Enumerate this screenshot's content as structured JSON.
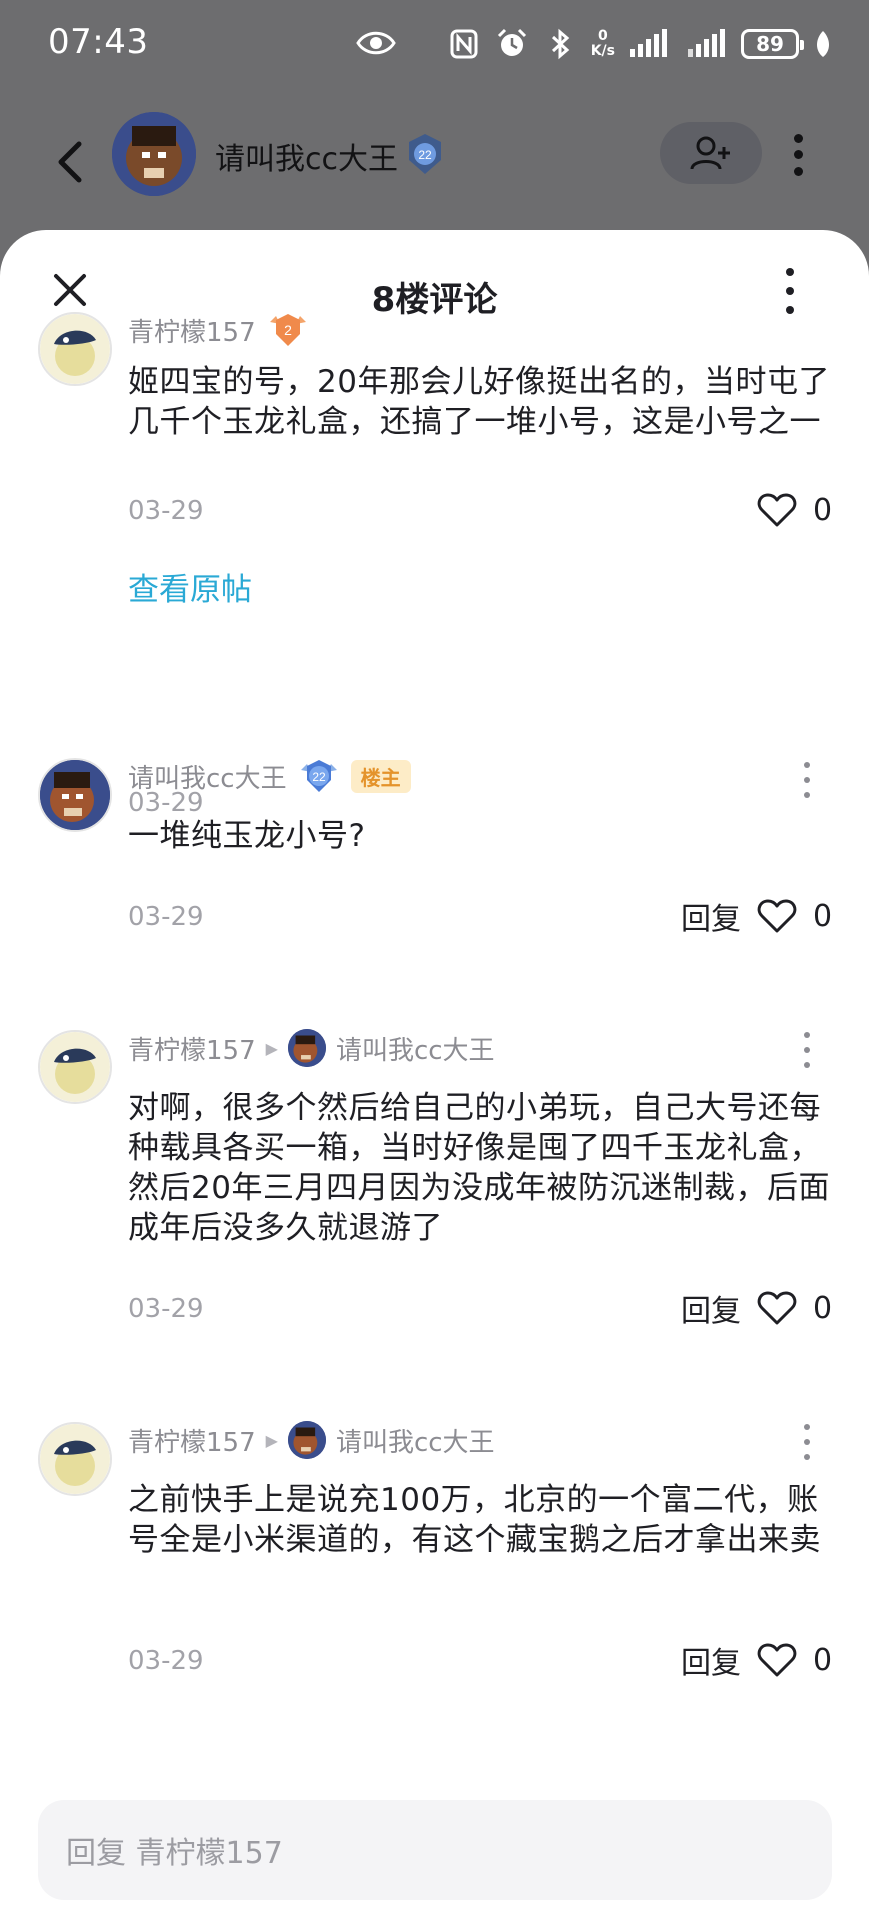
{
  "status_bar": {
    "time": "07:43",
    "net_speed_value": "0",
    "net_speed_unit": "K/s",
    "battery": "89"
  },
  "header": {
    "username": "请叫我cc大王",
    "level": "22"
  },
  "sheet": {
    "title": "8楼评论"
  },
  "comments": [
    {
      "user": "青柠檬157",
      "level": "2",
      "text": "姬四宝的号，20年那会儿好像挺出名的，当时屯了几千个玉龙礼盒，还搞了一堆小号，这是小号之一",
      "date": "03-29",
      "likes": "0",
      "view_post": "查看原帖"
    },
    {
      "user": "请叫我cc大王",
      "level": "22",
      "tag": "楼主",
      "text": "一堆纯玉龙小号?",
      "date": "03-29",
      "reply_label": "回复",
      "likes": "0"
    },
    {
      "user": "青柠檬157",
      "reply_to": "请叫我cc大王",
      "text": "对啊，很多个然后给自己的小弟玩，自己大号还每种载具各买一箱，当时好像是囤了四千玉龙礼盒，然后20年三月四月因为没成年被防沉迷制裁，后面成年后没多久就退游了",
      "date": "03-29",
      "reply_label": "回复",
      "likes": "0"
    },
    {
      "user": "青柠檬157",
      "reply_to": "请叫我cc大王",
      "text": "之前快手上是说充100万，北京的一个富二代，账号全是小米渠道的，有这个藏宝鹅之后才拿出来卖",
      "date": "03-29",
      "reply_label": "回复",
      "likes": "0"
    }
  ],
  "reply_input": {
    "placeholder": "回复 青柠檬157"
  },
  "colors": {
    "overlay": "#6d6d6f",
    "link_blue": "#2aa9d5",
    "owner_tag_bg": "#fdecc7",
    "owner_tag_text": "#e4932b",
    "level_orange": "#f08a4b",
    "level_blue": "#4a7bd6"
  },
  "icons": [
    "eye-icon",
    "nfc-icon",
    "alarm-icon",
    "bluetooth-icon",
    "signal-icon",
    "battery-icon",
    "back-icon",
    "add-user-icon",
    "more-icon",
    "close-icon",
    "heart-icon",
    "level-badge-icon"
  ]
}
